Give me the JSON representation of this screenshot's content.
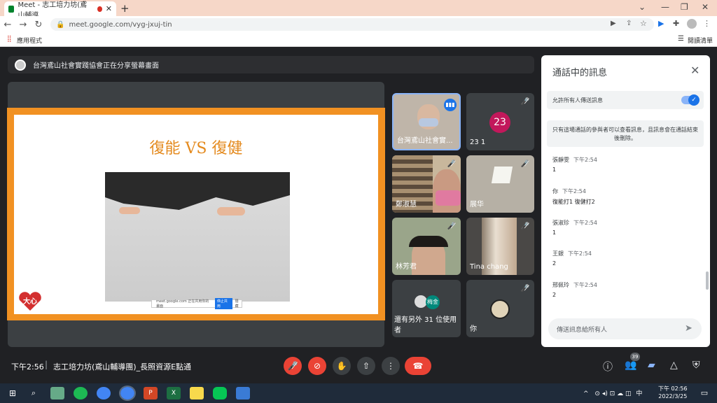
{
  "browser": {
    "tab_title": "Meet - 志工培力坊(鳶山輔導",
    "url": "meet.google.com/vyg-jxuj-tin",
    "bookmark_apps": "應用程式",
    "reading_list": "閱讀清單"
  },
  "meet": {
    "share_banner": "台灣鳶山社會實踐協會正在分享螢幕畫面",
    "slide_title": "復能 VS 復健",
    "slide_share_url": "meet.google.com 正在共用你的畫面",
    "slide_share_stop": "停止共用",
    "slide_share_hide": "隱藏",
    "logo_text": "大心",
    "tiles": [
      {
        "name": "台灣鳶山社會實...",
        "speaking": true
      },
      {
        "name": "23 1",
        "avatar_text": "23",
        "avatar_color": "#c2185b"
      },
      {
        "name": "鄭淑慧"
      },
      {
        "name": "展华"
      },
      {
        "name": "林芳君"
      },
      {
        "name": "Tina chang"
      },
      {
        "name": "還有另外 31 位使用者",
        "avatar_text": "梅金",
        "avatar_color": "#00897b"
      },
      {
        "name": "你"
      }
    ],
    "time": "下午2:56",
    "meeting_name": "志工培力坊(鳶山輔導團)_長照資源E點通",
    "participant_count": "39"
  },
  "chat": {
    "title": "通話中的訊息",
    "allow_label": "允許所有人傳送訊息",
    "notice": "只有這場通話的參與者可以查看訊息，且訊息會在通話結束後刪除。",
    "messages": [
      {
        "sender": "張靜雯",
        "time": "下午2:54",
        "text": "1"
      },
      {
        "sender": "你",
        "time": "下午2:54",
        "text": "復能打1 復健打2"
      },
      {
        "sender": "張淑珍",
        "time": "下午2:54",
        "text": "1"
      },
      {
        "sender": "王銀",
        "time": "下午2:54",
        "text": "2"
      },
      {
        "sender": "邢佩玲",
        "time": "下午2:54",
        "text": "2"
      }
    ],
    "input_placeholder": "傳送訊息給所有人"
  },
  "taskbar": {
    "ime": "中",
    "clock_time": "下午 02:56",
    "clock_date": "2022/3/25"
  },
  "colors": {
    "accent": "#1a73e8",
    "danger": "#ea4335",
    "slide_frame": "#f19122"
  }
}
